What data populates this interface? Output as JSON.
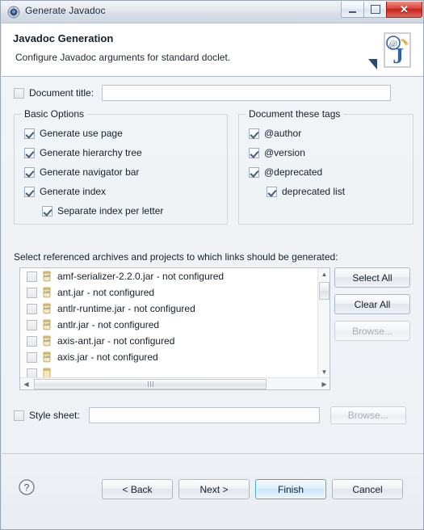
{
  "window": {
    "title": "Generate Javadoc",
    "title_icon": "javadoc-wizard-icon",
    "controls": {
      "minimize": "minimize-icon",
      "maximize": "maximize-icon",
      "close": "✕"
    }
  },
  "header": {
    "title": "Javadoc Generation",
    "subtitle": "Configure Javadoc arguments for standard doclet.",
    "banner_icon": "javadoc-banner-icon"
  },
  "document_title": {
    "label": "Document title:",
    "checked": false,
    "value": "",
    "placeholder": ""
  },
  "basic_options": {
    "legend": "Basic Options",
    "items": [
      {
        "label": "Generate use page",
        "checked": true,
        "indent": false
      },
      {
        "label": "Generate hierarchy tree",
        "checked": true,
        "indent": false
      },
      {
        "label": "Generate navigator bar",
        "checked": true,
        "indent": false
      },
      {
        "label": "Generate index",
        "checked": true,
        "indent": false
      },
      {
        "label": "Separate index per letter",
        "checked": true,
        "indent": true
      }
    ]
  },
  "document_tags": {
    "legend": "Document these tags",
    "items": [
      {
        "label": "@author",
        "checked": true,
        "indent": false
      },
      {
        "label": "@version",
        "checked": true,
        "indent": false
      },
      {
        "label": "@deprecated",
        "checked": true,
        "indent": false
      },
      {
        "label": "deprecated list",
        "checked": true,
        "indent": true
      }
    ]
  },
  "archives": {
    "label": "Select referenced archives and projects to which links should be generated:",
    "rows": [
      {
        "label": "amf-serializer-2.2.0.jar - not configured",
        "checked": false
      },
      {
        "label": "ant.jar - not configured",
        "checked": false
      },
      {
        "label": "antlr-runtime.jar - not configured",
        "checked": false
      },
      {
        "label": "antlr.jar - not configured",
        "checked": false
      },
      {
        "label": "axis-ant.jar - not configured",
        "checked": false
      },
      {
        "label": "axis.jar - not configured",
        "checked": false
      }
    ],
    "buttons": {
      "select_all": "Select All",
      "clear_all": "Clear All",
      "browse": "Browse..."
    },
    "scroll_up": "▲",
    "scroll_down": "▼",
    "scroll_left": "◀",
    "scroll_right": "▶"
  },
  "style_sheet": {
    "label": "Style sheet:",
    "checked": false,
    "value": "",
    "placeholder": "",
    "browse": "Browse..."
  },
  "footer": {
    "help": "help-icon",
    "buttons": [
      {
        "label": "< Back",
        "default": false,
        "disabled": false
      },
      {
        "label": "Next >",
        "default": false,
        "disabled": false
      },
      {
        "label": "Finish",
        "default": true,
        "disabled": false
      },
      {
        "label": "Cancel",
        "default": false,
        "disabled": false
      }
    ]
  },
  "colors": {
    "accent": "#4ba3cf",
    "close_red": "#c5201b",
    "javadoc_blue": "#2b4a78"
  }
}
